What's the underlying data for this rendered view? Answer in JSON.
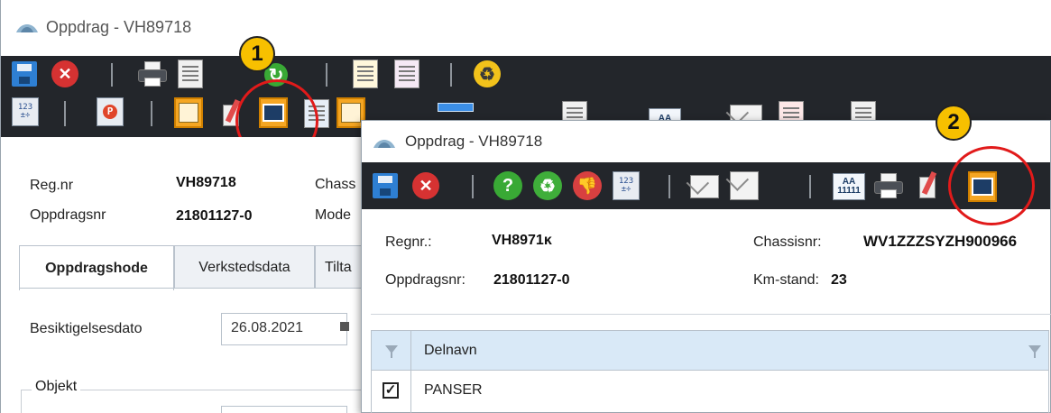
{
  "back_window": {
    "title": "Oppdrag - VH89718",
    "fields": {
      "regnr_label": "Reg.nr",
      "regnr_value": "VH89718",
      "oppdragsnr_label": "Oppdragsnr",
      "oppdragsnr_value": "21801127-0",
      "chassis_label_partial": "Chass",
      "modell_label_partial": "Mode"
    },
    "tabs": [
      "Oppdragshode",
      "Verkstedsdata",
      "Tilta"
    ],
    "besiktigelse_label": "Besiktigelsesdato",
    "besiktigelse_value": "26.08.2021",
    "group_label": "Objekt",
    "toolbar_icons": [
      "save-icon",
      "cancel-icon",
      "print-icon",
      "copy-document-icon",
      "report-icon",
      "edit-document-icon",
      "recycle-icon",
      "calculator-icon",
      "parking-calculator-icon",
      "gold-document-icon",
      "pencil-notepad-icon",
      "photo-icon"
    ]
  },
  "front_window": {
    "title": "Oppdrag - VH89718",
    "regnr_label": "Regnr.:",
    "regnr_value": "VH8971ĸ",
    "chassisnr_label": "Chassisnr:",
    "chassisnr_value": "WV1ZZZSYZH900966",
    "oppdragsnr_label": "Oppdragsnr:",
    "oppdragsnr_value": "21801127-0",
    "kmstand_label": "Km-stand:",
    "kmstand_value": "23",
    "grid": {
      "column_header": "Delnavn",
      "rows": [
        {
          "checked": true,
          "name": "PANSER"
        }
      ]
    },
    "toolbar_icons": [
      "save-icon",
      "cancel-icon",
      "help-icon",
      "recycle-icon",
      "thumbs-down-icon",
      "calculator-icon",
      "add-mail-icon",
      "exchange-mail-icon",
      "font-aa-icon",
      "print-icon",
      "pencil-notepad-icon",
      "photo-icon"
    ]
  },
  "annotations": {
    "badge_1": "1",
    "badge_2": "2",
    "marker_color": "#e11a1a",
    "badge_color": "#f7c000"
  },
  "colors": {
    "toolbar_bg": "#23262b",
    "grid_header_bg": "#d9e9f7"
  }
}
